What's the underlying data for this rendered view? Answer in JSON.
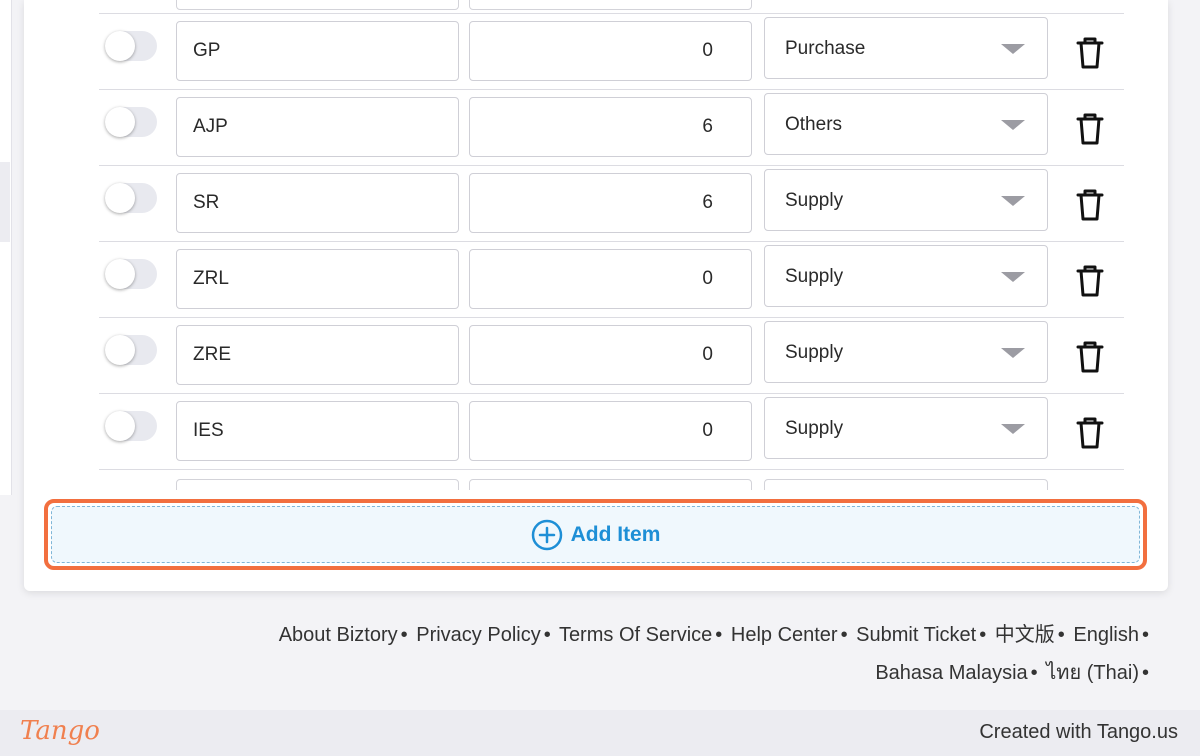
{
  "rows": [
    {
      "code": "GP",
      "qty": "0",
      "type": "Purchase"
    },
    {
      "code": "AJP",
      "qty": "6",
      "type": "Others"
    },
    {
      "code": "SR",
      "qty": "6",
      "type": "Supply"
    },
    {
      "code": "ZRL",
      "qty": "0",
      "type": "Supply"
    },
    {
      "code": "ZRE",
      "qty": "0",
      "type": "Supply"
    },
    {
      "code": "IES",
      "qty": "0",
      "type": "Supply"
    }
  ],
  "add_item": {
    "label": "Add Item"
  },
  "footer": {
    "links": [
      "About Biztory",
      "Privacy Policy",
      "Terms Of Service",
      "Help Center",
      "Submit Ticket",
      "中文版",
      "English",
      "Bahasa Malaysia",
      "ไทย (Thai)"
    ],
    "separator": "•"
  },
  "tango": {
    "logo": "Tango",
    "credit": "Created with Tango.us"
  },
  "colors": {
    "accent": "#1e8fd6",
    "highlight": "#f26f3f"
  }
}
